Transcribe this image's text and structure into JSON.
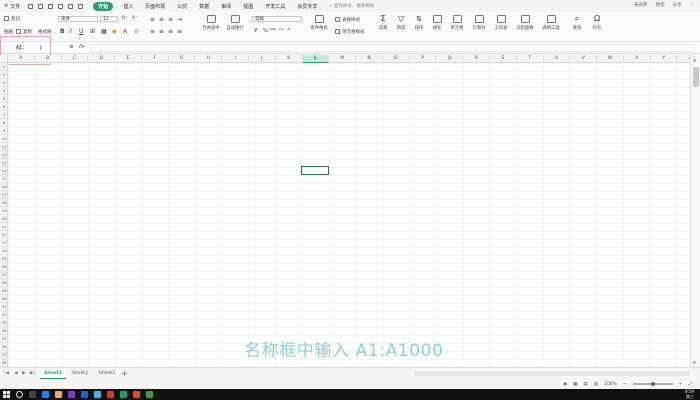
{
  "menubar": {
    "file_label": "文件",
    "tabs": [
      {
        "label": "开始",
        "active": true
      },
      {
        "label": "插入",
        "active": false
      },
      {
        "label": "页面布局",
        "active": false
      },
      {
        "label": "公式",
        "active": false
      },
      {
        "label": "数据",
        "active": false
      },
      {
        "label": "审阅",
        "active": false
      },
      {
        "label": "视图",
        "active": false
      },
      {
        "label": "开发工具",
        "active": false
      },
      {
        "label": "会员专享",
        "active": false
      }
    ],
    "search_placeholder": "查找命令、搜索模板",
    "right": {
      "sync": "未同步",
      "collab": "协作",
      "share": "分享"
    }
  },
  "ribbon": {
    "cut": "剪切",
    "paste": "粘贴",
    "copy": "复制",
    "format_painter": "格式刷",
    "font_name": "宋体",
    "font_size": "12",
    "number_format": "常规",
    "merge_center": "合并居中",
    "wrap_text": "自动换行",
    "conditional_format": "条件格式",
    "table_style": "表格样式",
    "cell_style": "单元格样式",
    "sum": "求和",
    "filter": "筛选",
    "sort": "排序",
    "fill": "填充",
    "cells": "单元格",
    "rows_cols": "行和列",
    "worksheet": "工作表",
    "freeze": "冻结窗格",
    "table_tools": "表格工具",
    "find": "查找",
    "symbol": "符号"
  },
  "formulabar": {
    "name_box_value": "A1:",
    "fx_label": "fx",
    "formula_value": ""
  },
  "sheet": {
    "columns": [
      "A",
      "B",
      "C",
      "D",
      "E",
      "F",
      "G",
      "H",
      "I",
      "J",
      "K",
      "L",
      "M",
      "N",
      "O",
      "P",
      "Q",
      "R",
      "S",
      "T",
      "U",
      "V",
      "W",
      "X",
      "Y",
      "Z"
    ],
    "selected_column": "L",
    "rows": [
      "1",
      "2",
      "3",
      "4",
      "5",
      "6",
      "7",
      "8",
      "9",
      "10",
      "11",
      "12",
      "13",
      "14",
      "15",
      "16",
      "17",
      "18",
      "19",
      "20",
      "21",
      "22",
      "23",
      "24",
      "25",
      "26",
      "27",
      "28",
      "29",
      "30",
      "31",
      "32",
      "33",
      "34",
      "35",
      "36",
      "37",
      "38"
    ]
  },
  "caption": "名称框中输入 A1:A1000",
  "sheet_tabs": [
    {
      "label": "Sheet1",
      "active": true
    },
    {
      "label": "Sheet2",
      "active": false
    },
    {
      "label": "Sheet3",
      "active": false
    }
  ],
  "statusbar": {
    "zoom": "100%"
  },
  "taskbar": {
    "time": "9:59",
    "day": "周三"
  },
  "colors": {
    "accent": "#1f9e6e",
    "highlight_box": "#e9a5a5",
    "caption": "#8dd0dd"
  }
}
